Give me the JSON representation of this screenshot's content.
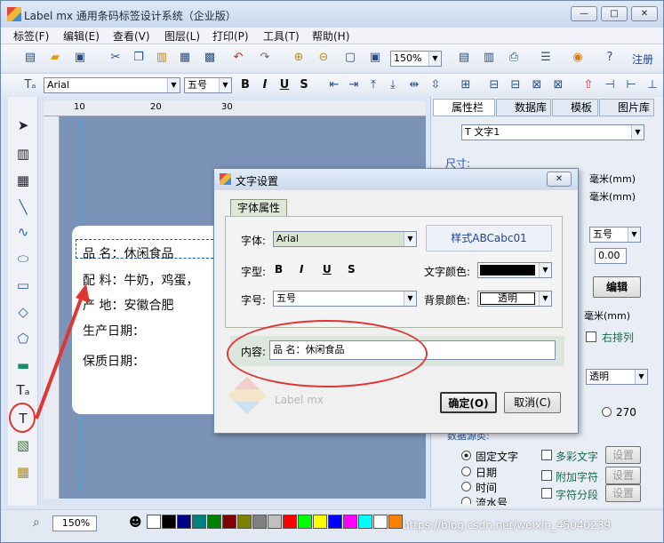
{
  "window": {
    "title": "Label mx 通用条码标签设计系统（企业版）"
  },
  "menu": [
    "标签(F)",
    "编辑(E)",
    "查看(V)",
    "图层(L)",
    "打印(P)",
    "工具(T)",
    "帮助(H)"
  ],
  "toolbar1": {
    "zoom_value": "150%",
    "register_label": "注册"
  },
  "toolbar2": {
    "font_family": "Arial",
    "font_size": "五号",
    "bold": "B",
    "italic": "I",
    "underline": "U",
    "strike": "S"
  },
  "label": {
    "lines": [
      "品 名：休闲食品",
      "配 料：牛奶，鸡蛋，",
      "产 地：安徽合肥",
      "生产日期：",
      "保质日期："
    ]
  },
  "right_panel": {
    "tabs": [
      "属性栏",
      "数据库",
      "模板",
      "图片库"
    ],
    "object_select": "T 文字1",
    "size_label": "尺寸:",
    "unit_mm_1": "毫米(mm)",
    "unit_mm_2": "毫米(mm)",
    "font_size": "五号",
    "num_value": "0.00",
    "edit_button": "编辑",
    "unit_mm_3": "毫米(mm)",
    "right_align": "右排列",
    "transparent": "透明",
    "angle_270": "270",
    "data_source_label": "数据源类:",
    "data_options": [
      "固定文字",
      "日期",
      "时间",
      "流水号"
    ],
    "extra_options": [
      "多彩文字",
      "附加字符",
      "字符分段"
    ],
    "setting_label": "设置"
  },
  "dialog": {
    "title": "文字设置",
    "tab": "字体属性",
    "font_label": "字体:",
    "font_value": "Arial",
    "style_preview": "样式ABCabc01",
    "style_label": "字型:",
    "text_color_label": "文字颜色:",
    "size_label": "字号:",
    "size_value": "五号",
    "bg_color_label": "背景颜色:",
    "bg_color_value": "透明",
    "content_label": "内容:",
    "content_value": "品 名：休闲食品",
    "watermark": "Label mx",
    "ok_button": "确定(O)",
    "cancel_button": "取消(C)"
  },
  "status": {
    "zoom": "150%",
    "watermark_text": "https://blog.csdn.net/weixin_45040239"
  },
  "colors": {
    "accent_red": "#e13535",
    "canvas_bg": "#7b93b7",
    "palette": [
      "#000000",
      "#000080",
      "#008080",
      "#008000",
      "#800000",
      "#808000",
      "#808080",
      "#c0c0c0",
      "#ff0000",
      "#00ff00",
      "#ffff00",
      "#0000ff",
      "#ff00ff",
      "#00ffff",
      "#ffffff",
      "#ff8000",
      "#8000ff",
      "#0080ff"
    ]
  }
}
